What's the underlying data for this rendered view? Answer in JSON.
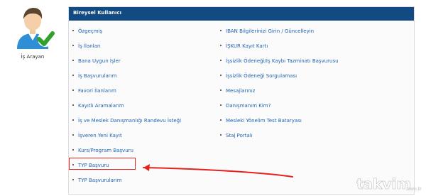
{
  "user": {
    "role_label": "İş Arayan"
  },
  "panel": {
    "title": "Bireysel Kullanıcı",
    "left_column": [
      "Özgeçmiş",
      "İş İlanları",
      "Bana Uygun İşler",
      "İş Başvurularım",
      "Favori İlanlarım",
      "Kayıtlı Aramalarım",
      "İş ve Meslek Danışmanlığı Randevu İsteği",
      "İşveren Yeni Kayıt",
      "Kurs/Program Başvuru",
      "TYP Başvuru",
      "TYP Başvurularım"
    ],
    "right_column": [
      "IBAN Bilgilerinizi Girin / Güncelleyin",
      "İŞKUR Kayıt Kartı",
      "İşsizlik Ödeneği/İş Kaybı Tazminatı Başvurusu",
      "İşsizlik Ödeneği Sorgulaması",
      "Mesajlarınız",
      "Danışmanım Kim?",
      "Mesleki Yönelim Test Bataryası",
      "Staj Portalı"
    ]
  },
  "watermark": {
    "text": "takvim",
    "domain": ".com.tr"
  },
  "colors": {
    "header": "#124a84",
    "link": "#1e63b0",
    "annotation": "#e5221e",
    "check": "#33a02c"
  }
}
